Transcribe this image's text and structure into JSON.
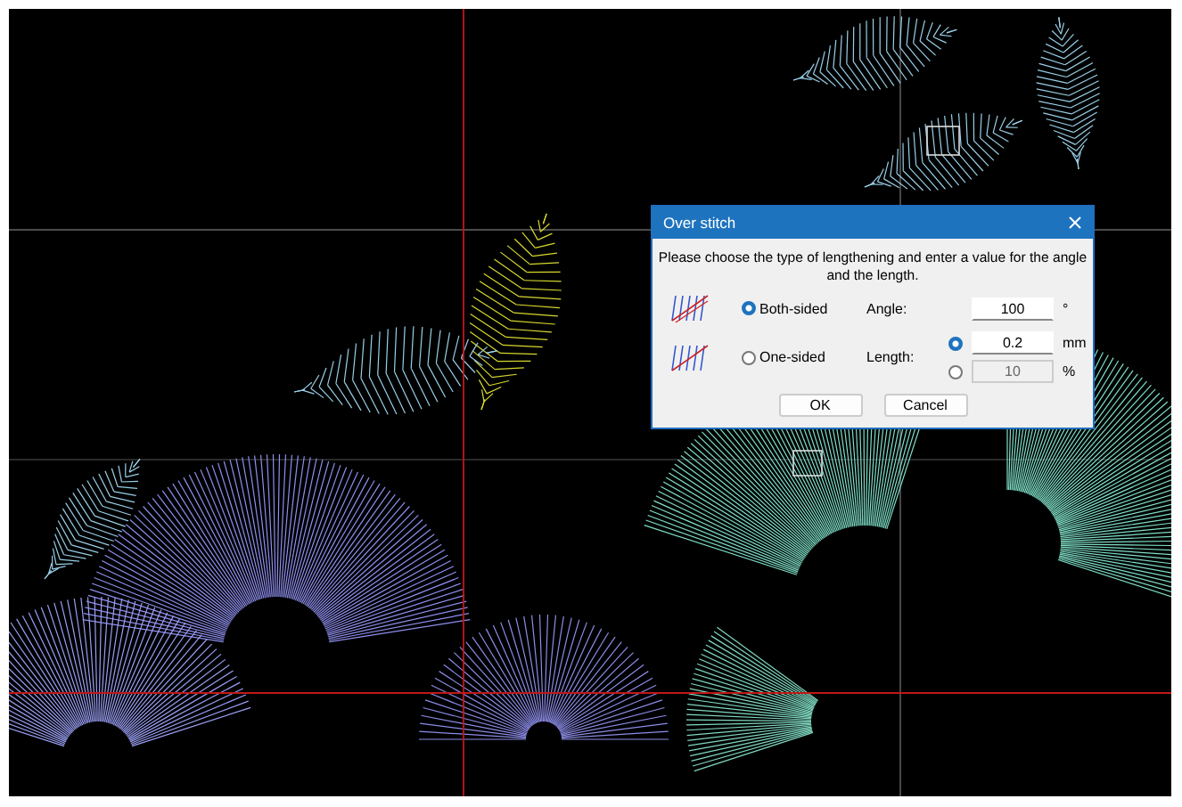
{
  "dialog": {
    "title": "Over stitch",
    "message": "Please choose the type of lengthening and enter a value for the angle and the length.",
    "types": [
      {
        "label": "Both-sided",
        "selected": true
      },
      {
        "label": "One-sided",
        "selected": false
      }
    ],
    "angle": {
      "label": "Angle:",
      "value": "100",
      "unit": "°"
    },
    "length": {
      "label": "Length:",
      "options": [
        {
          "value": "0.2",
          "unit": "mm",
          "selected": true,
          "disabled": false
        },
        {
          "value": "10",
          "unit": "%",
          "selected": false,
          "disabled": true
        }
      ]
    },
    "buttons": [
      "OK",
      "Cancel"
    ]
  }
}
